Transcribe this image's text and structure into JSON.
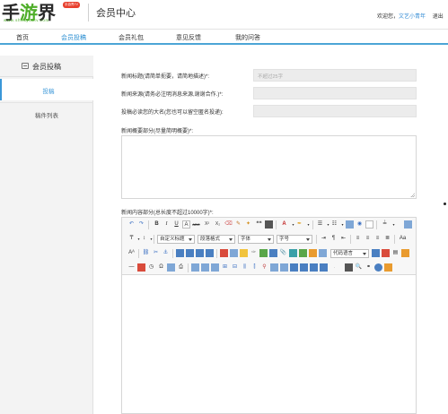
{
  "header": {
    "logo_text_a": "手",
    "logo_text_b": "游",
    "logo_text_c": "界",
    "logo_sub": "www.shouyoutv.com",
    "logo_badge": "手游界TV",
    "title": "会员中心",
    "welcome": "欢迎您，",
    "username": "文艺小青年",
    "logout": "退出"
  },
  "nav": {
    "items": [
      {
        "label": "首页"
      },
      {
        "label": "会员投稿"
      },
      {
        "label": "会员礼包"
      },
      {
        "label": "意见反馈"
      },
      {
        "label": "我的问答"
      }
    ]
  },
  "sidebar": {
    "heading": "会员投稿",
    "items": [
      {
        "label": "投稿"
      },
      {
        "label": "稿件列表"
      }
    ]
  },
  "form": {
    "title_label": "新闻标题(请简单扼要，请简地描述)*:",
    "title_placeholder": "不超过25字",
    "source_label": "新闻来源(请务必注明消息来源,谢谢合作.)*:",
    "author_label": "投稿必读您的大名(您也可以留空匿名投递):",
    "summary_label": "新闻概要部分(尽量简明概要)*:",
    "content_label": "新闻内容部分(总长度不超过10000字)*:"
  },
  "editor": {
    "select_custom_title": "自定义标题",
    "select_paragraph": "段落格式",
    "select_font": "字体",
    "select_size": "字号",
    "select_code_lang": "代码语言",
    "btn_bold": "B",
    "btn_italic": "I",
    "btn_underline": "U",
    "btn_strike": "ABC",
    "btn_sup": "X²",
    "btn_sub": "X₂",
    "btn_quote": "❝❝",
    "btn_fontcolor": "A"
  }
}
